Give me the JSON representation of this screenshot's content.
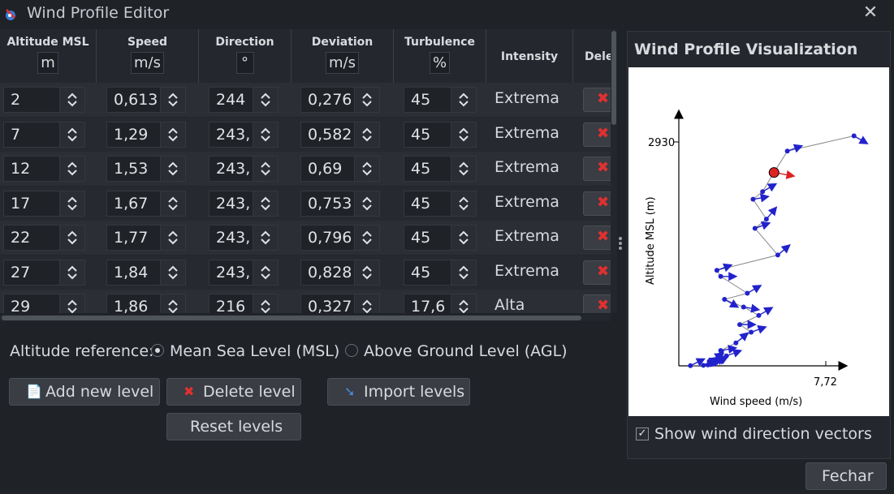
{
  "window": {
    "title": "Wind Profile Editor"
  },
  "table": {
    "columns": [
      {
        "label": "Altitude MSL",
        "unit": "m"
      },
      {
        "label": "Speed",
        "unit": "m/s"
      },
      {
        "label": "Direction",
        "unit": "°"
      },
      {
        "label": "Deviation",
        "unit": "m/s"
      },
      {
        "label": "Turbulence",
        "unit": "%"
      },
      {
        "label": "Intensity",
        "unit": ""
      },
      {
        "label": "Dele",
        "unit": ""
      }
    ],
    "rows": [
      {
        "altitude": "2",
        "speed": "0,613",
        "direction": "244",
        "deviation": "0,276",
        "turbulence": "45",
        "intensity": "Extrema"
      },
      {
        "altitude": "7",
        "speed": "1,29",
        "direction": "243,",
        "deviation": "0,582",
        "turbulence": "45",
        "intensity": "Extrema"
      },
      {
        "altitude": "12",
        "speed": "1,53",
        "direction": "243,",
        "deviation": "0,69",
        "turbulence": "45",
        "intensity": "Extrema"
      },
      {
        "altitude": "17",
        "speed": "1,67",
        "direction": "243,",
        "deviation": "0,753",
        "turbulence": "45",
        "intensity": "Extrema"
      },
      {
        "altitude": "22",
        "speed": "1,77",
        "direction": "243,",
        "deviation": "0,796",
        "turbulence": "45",
        "intensity": "Extrema"
      },
      {
        "altitude": "27",
        "speed": "1,84",
        "direction": "243,",
        "deviation": "0,828",
        "turbulence": "45",
        "intensity": "Extrema"
      },
      {
        "altitude": "29",
        "speed": "1,86",
        "direction": "216",
        "deviation": "0,327",
        "turbulence": "17,6",
        "intensity": "Alta"
      }
    ]
  },
  "altitude_reference": {
    "label": "Altitude reference:",
    "options": [
      {
        "label": "Mean Sea Level (MSL)",
        "checked": true
      },
      {
        "label": "Above Ground Level (AGL)",
        "checked": false
      }
    ]
  },
  "buttons": {
    "add": "Add new level",
    "delete": "Delete level",
    "import": "Import levels",
    "reset": "Reset levels",
    "close": "Fechar"
  },
  "visualization": {
    "title": "Wind Profile Visualization",
    "show_vectors_label": "Show wind direction vectors",
    "show_vectors_checked": true,
    "colors": {
      "path": "#888888",
      "point": "#2222cc",
      "selected": "#dd2222"
    }
  },
  "chart_data": {
    "type": "scatter",
    "xlabel": "Wind speed (m/s)",
    "ylabel": "Altitude MSL (m)",
    "x_tick_label": "7,72",
    "y_tick_label": "2930",
    "xlim": [
      0,
      8.3
    ],
    "ylim": [
      0,
      3280
    ],
    "points": [
      {
        "speed": 0.61,
        "alt": 2,
        "dir": 244
      },
      {
        "speed": 1.29,
        "alt": 7,
        "dir": 243
      },
      {
        "speed": 1.53,
        "alt": 12,
        "dir": 243
      },
      {
        "speed": 1.67,
        "alt": 17,
        "dir": 243
      },
      {
        "speed": 1.77,
        "alt": 22,
        "dir": 243
      },
      {
        "speed": 1.84,
        "alt": 27,
        "dir": 243
      },
      {
        "speed": 1.86,
        "alt": 29,
        "dir": 216
      },
      {
        "speed": 2.5,
        "alt": 130,
        "dir": 250
      },
      {
        "speed": 1.6,
        "alt": 60,
        "dir": 240
      },
      {
        "speed": 2.2,
        "alt": 200,
        "dir": 260
      },
      {
        "speed": 3.0,
        "alt": 300,
        "dir": 230
      },
      {
        "speed": 3.8,
        "alt": 440,
        "dir": 250
      },
      {
        "speed": 3.2,
        "alt": 540,
        "dir": 270
      },
      {
        "speed": 4.2,
        "alt": 660,
        "dir": 240
      },
      {
        "speed": 3.4,
        "alt": 770,
        "dir": 280
      },
      {
        "speed": 2.4,
        "alt": 870,
        "dir": 300
      },
      {
        "speed": 3.6,
        "alt": 950,
        "dir": 240
      },
      {
        "speed": 2.2,
        "alt": 1170,
        "dir": 270
      },
      {
        "speed": 2.0,
        "alt": 1250,
        "dir": 250
      },
      {
        "speed": 5.2,
        "alt": 1450,
        "dir": 230
      },
      {
        "speed": 4.0,
        "alt": 1800,
        "dir": 250
      },
      {
        "speed": 4.6,
        "alt": 1920,
        "dir": 220
      },
      {
        "speed": 3.9,
        "alt": 2180,
        "dir": 260
      },
      {
        "speed": 4.4,
        "alt": 2280,
        "dir": 240
      },
      {
        "speed": 5.0,
        "alt": 2530,
        "dir": 280,
        "selected": true
      },
      {
        "speed": 5.7,
        "alt": 2810,
        "dir": 250
      },
      {
        "speed": 9.2,
        "alt": 3010,
        "dir": 300
      }
    ]
  }
}
